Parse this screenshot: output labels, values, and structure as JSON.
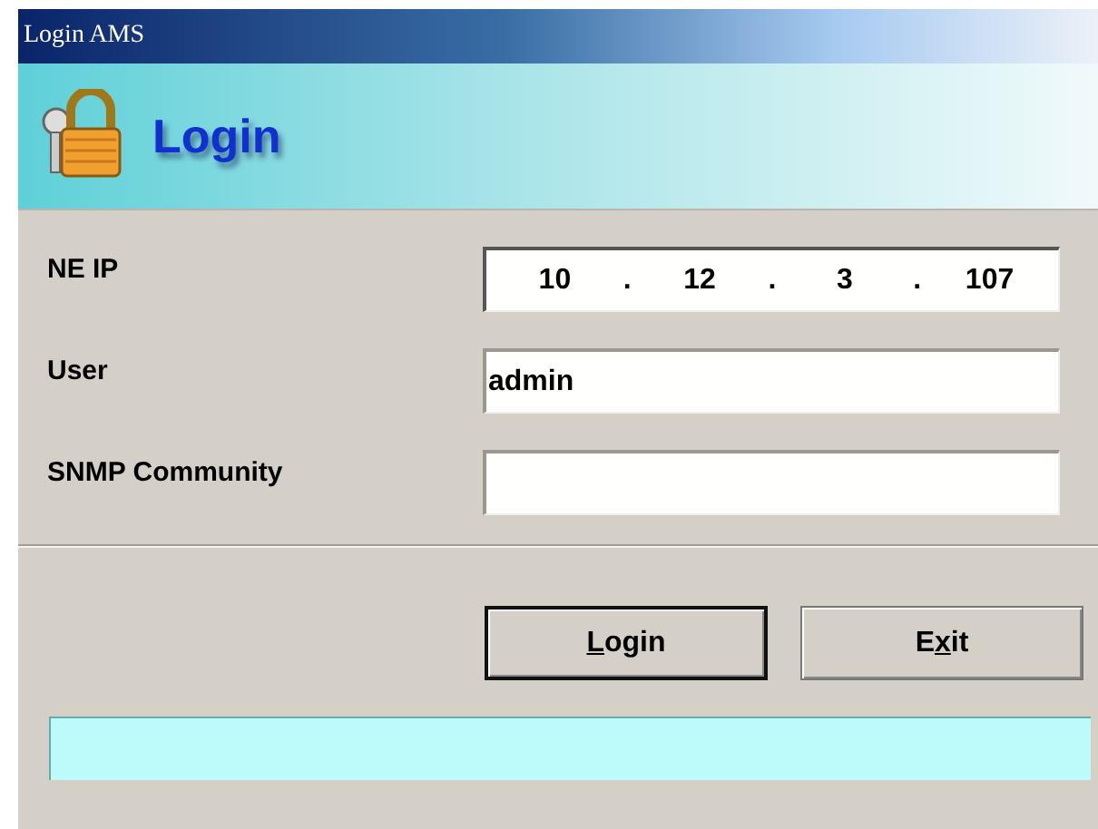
{
  "window": {
    "title": "Login AMS"
  },
  "header": {
    "title": "Login"
  },
  "fields": [
    {
      "kind": "ip",
      "label": "NE IP",
      "parts": [
        "10",
        ".",
        "12",
        ".",
        "3",
        ".",
        "107"
      ]
    },
    {
      "kind": "text",
      "label": "User",
      "value": "admin"
    },
    {
      "kind": "text",
      "label": "SNMP Community"
    }
  ],
  "buttons": [
    {
      "access_key": "L",
      "label_end": "ogin",
      "default": true
    },
    {
      "label_start": "E",
      "access_key": "x",
      "label_end": "it",
      "default": false
    }
  ]
}
